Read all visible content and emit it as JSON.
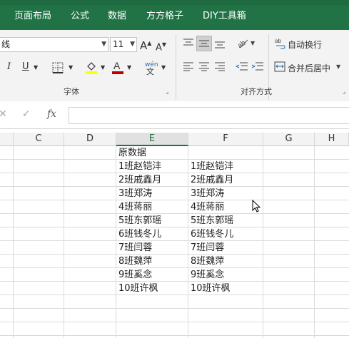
{
  "ribbon_tabs": [
    "页面布局",
    "公式",
    "数据",
    "方方格子",
    "DIY工具箱"
  ],
  "font": {
    "name": "线",
    "size": "11",
    "grow_label": "A",
    "shrink_label": "A",
    "group_label": "字体",
    "phonetic_label": "wén"
  },
  "alignment": {
    "wrap_text_label": "自动换行",
    "merge_center_label": "合并后居中",
    "group_label": "对齐方式"
  },
  "formula_bar": {
    "fx_label": "fx",
    "value": ""
  },
  "columns": [
    "C",
    "D",
    "E",
    "F",
    "G",
    "H"
  ],
  "active_column": "E",
  "sheet": {
    "E_header": "原数据",
    "rows": [
      {
        "e": "1班赵铠沣",
        "f": "1班赵铠沣"
      },
      {
        "e": "2班戚鑫月",
        "f": "2班戚鑫月"
      },
      {
        "e": "3班郑涛",
        "f": "3班郑涛"
      },
      {
        "e": "4班蒋丽",
        "f": "4班蒋丽"
      },
      {
        "e": "5班东郭瑶",
        "f": "5班东郭瑶"
      },
      {
        "e": "6班钱冬儿",
        "f": "6班钱冬儿"
      },
      {
        "e": "7班闫蓉",
        "f": "7班闫蓉"
      },
      {
        "e": "8班魏萍",
        "f": "8班魏萍"
      },
      {
        "e": "9班奚念",
        "f": "9班奚念"
      },
      {
        "e": "10班许枫",
        "f": "10班许枫"
      }
    ]
  },
  "colors": {
    "ribbon_tab_bg": "#217346",
    "font_color_underline": "#c00000",
    "highlight_underline": "#ffff00",
    "active_header": "#217346"
  }
}
